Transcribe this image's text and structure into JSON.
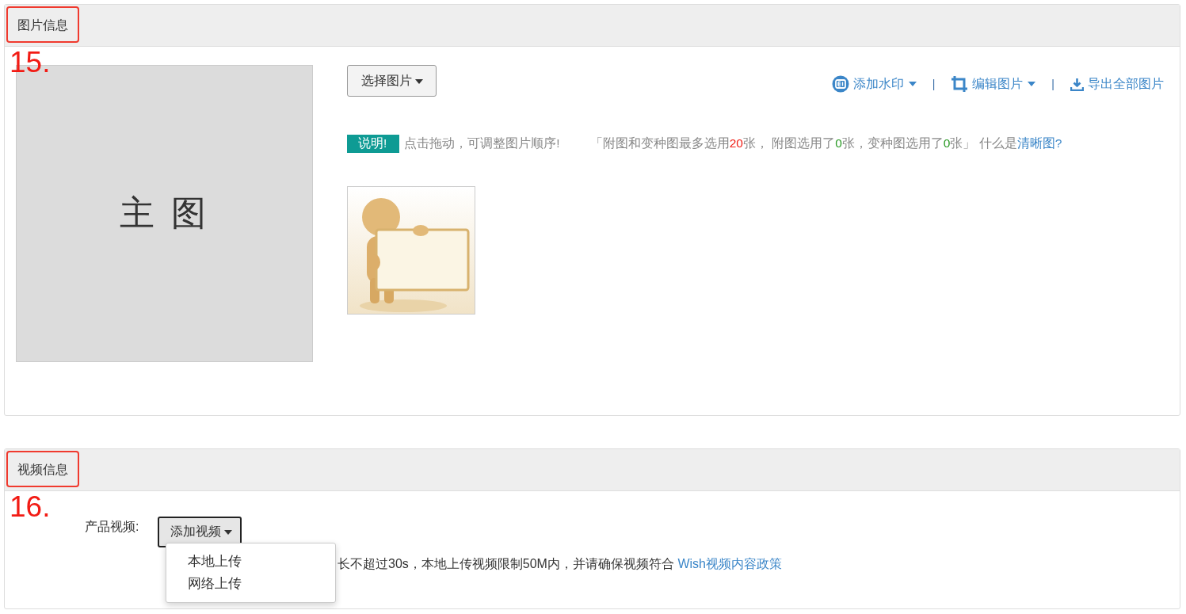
{
  "image_section": {
    "title": "图片信息",
    "annotation": "15.",
    "main_image": {
      "label": "主 图"
    },
    "select_button": {
      "label": "选择图片",
      "dropdown": true
    },
    "toolbar": [
      {
        "kind": "watermark",
        "label": "添加水印",
        "dropdown": true
      },
      {
        "kind": "separator",
        "label": "|"
      },
      {
        "kind": "crop",
        "label": "编辑图片",
        "dropdown": true
      },
      {
        "kind": "separator",
        "label": "|"
      },
      {
        "kind": "download",
        "label": "导出全部图片",
        "dropdown": false
      }
    ],
    "notice": {
      "badge": "说明!",
      "hint": "点击拖动，可调整图片顺序!",
      "segments": [
        {
          "kind": "text",
          "text": "「附图和变种图最多选用"
        },
        {
          "kind": "limit",
          "text": "20"
        },
        {
          "kind": "text",
          "text": "张， 附图选用了"
        },
        {
          "kind": "count",
          "text": "0"
        },
        {
          "kind": "text",
          "text": "张，变种图选用了"
        },
        {
          "kind": "count",
          "text": "0"
        },
        {
          "kind": "text",
          "text": "张」 什么是"
        }
      ],
      "link": "清晰图?"
    }
  },
  "video_section": {
    "title": "视频信息",
    "annotation": "16.",
    "label": "产品视频:",
    "button": {
      "label": "添加视频",
      "expanded": true
    },
    "menu": [
      "本地上传",
      "网络上传"
    ],
    "note": "长不超过30s，本地上传视频限制50M内，并请确保视频符合",
    "note_link": "Wish视频内容政策"
  }
}
